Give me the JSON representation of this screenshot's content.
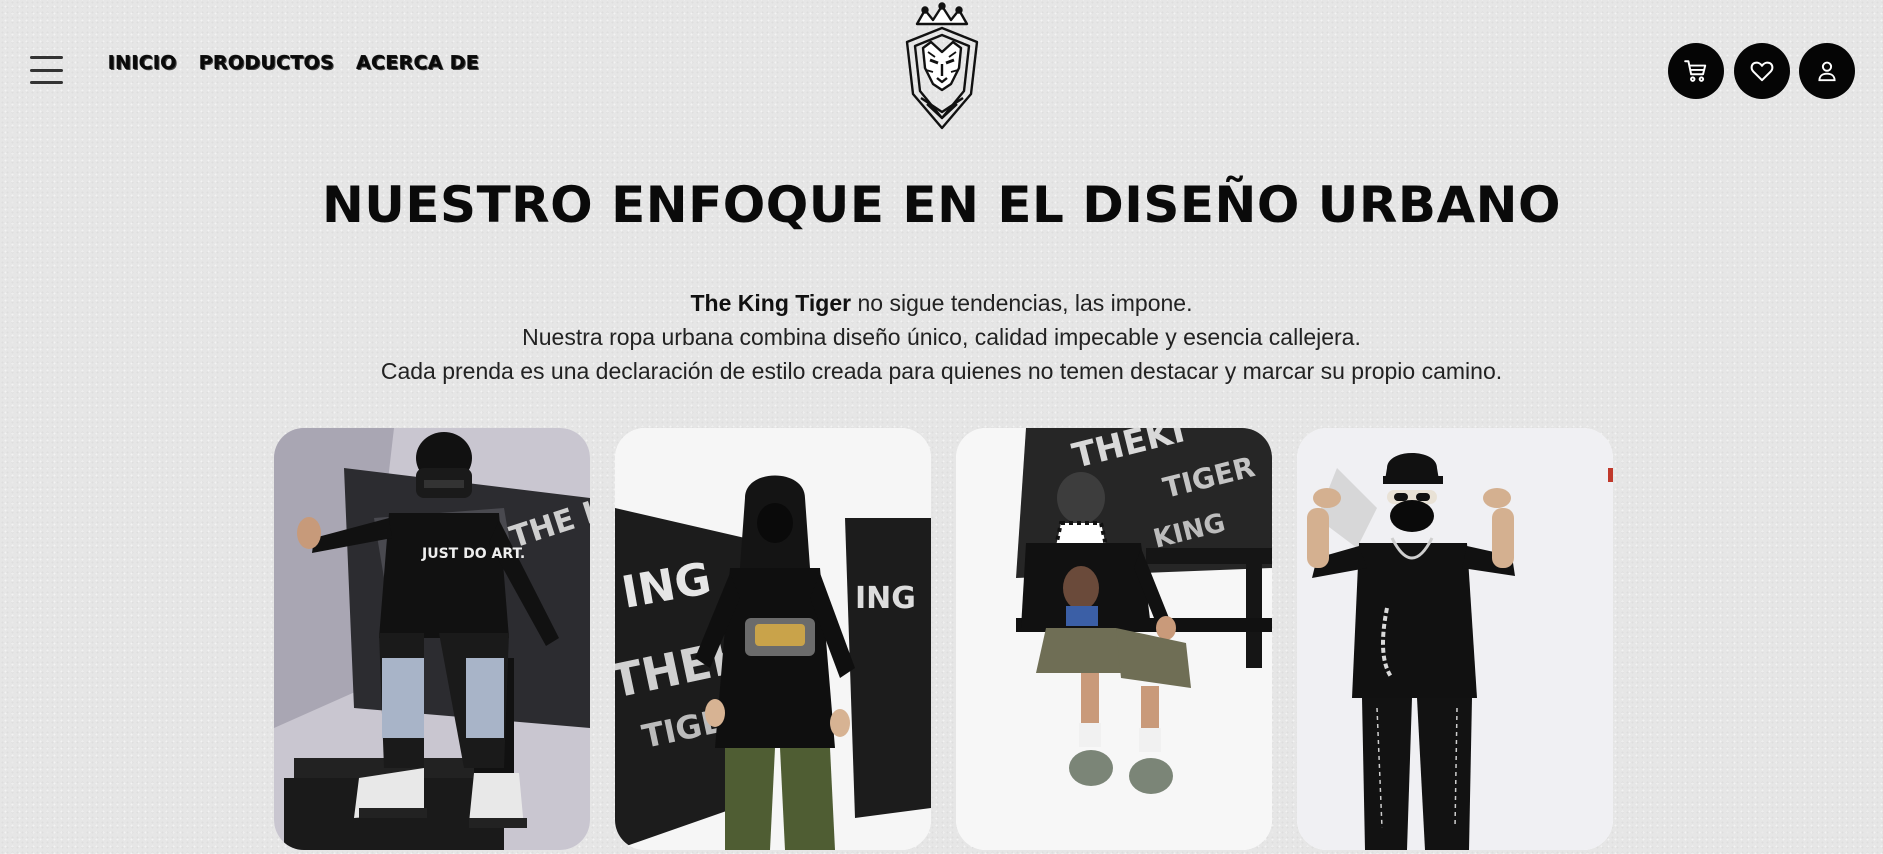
{
  "header": {
    "nav": [
      "INICIO",
      "PRODUCTOS",
      "ACERCA DE"
    ],
    "icons": {
      "menu": "hamburger-menu-icon",
      "logo": "king-tiger-logo",
      "cart": "cart-icon",
      "favorites": "heart-icon",
      "account": "user-icon"
    }
  },
  "section": {
    "title": "NUESTRO ENFOQUE EN EL DISEÑO URBANO",
    "brand": "The King Tiger",
    "line1_rest": " no sigue tendencias, las impone.",
    "line2": "Nuestra ropa urbana combina diseño único, calidad impecable y esencia callejera.",
    "line3": "Cada prenda es una declaración de estilo creada para quienes no temen destacar y marcar su propio camino."
  },
  "gallery": {
    "items": [
      {
        "shirt_text": "JUST DO ART."
      },
      {},
      {},
      {}
    ],
    "banner_text": "THE KING TIGER"
  },
  "colors": {
    "background": "#e6e6e6",
    "text": "#0a0a0a",
    "button_bg": "#050505",
    "button_icon": "#ffffff"
  }
}
